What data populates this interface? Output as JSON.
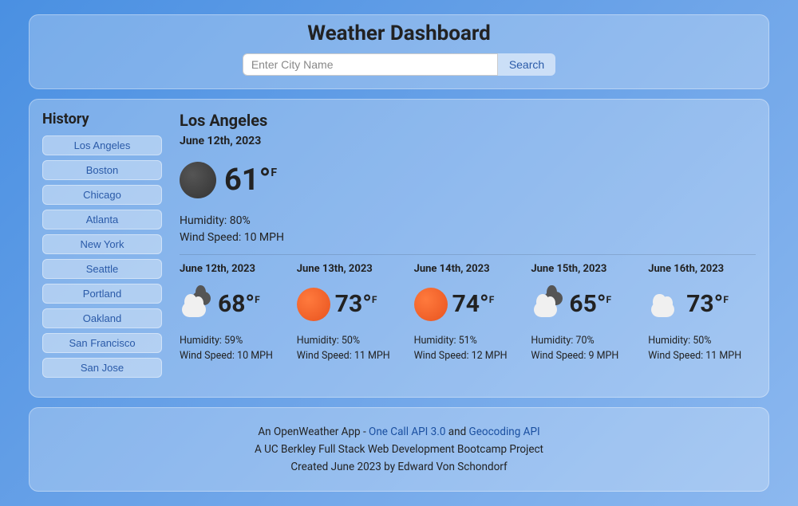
{
  "header": {
    "title": "Weather Dashboard",
    "search_placeholder": "Enter City Name",
    "search_button": "Search"
  },
  "history": {
    "title": "History",
    "items": [
      "Los Angeles",
      "Boston",
      "Chicago",
      "Atlanta",
      "New York",
      "Seattle",
      "Portland",
      "Oakland",
      "San Francisco",
      "San Jose"
    ]
  },
  "current": {
    "city": "Los Angeles",
    "date": "June 12th, 2023",
    "temp": "61°",
    "unit": "F",
    "icon": "dark-circle",
    "humidity_label": "Humidity: 80%",
    "wind_label": "Wind Speed: 10 MPH"
  },
  "forecast": [
    {
      "date": "June 12th, 2023",
      "icon": "cloud-dark",
      "temp": "68°",
      "unit": "F",
      "humidity": "Humidity: 59%",
      "wind": "Wind Speed: 10 MPH"
    },
    {
      "date": "June 13th, 2023",
      "icon": "sun",
      "temp": "73°",
      "unit": "F",
      "humidity": "Humidity: 50%",
      "wind": "Wind Speed: 11 MPH"
    },
    {
      "date": "June 14th, 2023",
      "icon": "sun",
      "temp": "74°",
      "unit": "F",
      "humidity": "Humidity: 51%",
      "wind": "Wind Speed: 12 MPH"
    },
    {
      "date": "June 15th, 2023",
      "icon": "cloud-dark",
      "temp": "65°",
      "unit": "F",
      "humidity": "Humidity: 70%",
      "wind": "Wind Speed: 9 MPH"
    },
    {
      "date": "June 16th, 2023",
      "icon": "cloud",
      "temp": "73°",
      "unit": "F",
      "humidity": "Humidity: 50%",
      "wind": "Wind Speed: 11 MPH"
    }
  ],
  "footer": {
    "line1_a": "An OpenWeather App - ",
    "link1": "One Call API 3.0",
    "line1_b": " and ",
    "link2": "Geocoding API",
    "line2": "A UC Berkley Full Stack Web Development Bootcamp Project",
    "line3": "Created June 2023 by Edward Von Schondorf"
  }
}
